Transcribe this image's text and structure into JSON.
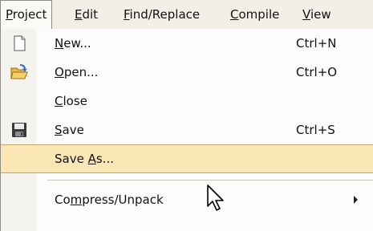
{
  "menubar": {
    "items": [
      {
        "label": "Project",
        "mnemonic": "P",
        "active": true
      },
      {
        "label": "Edit",
        "mnemonic": "E"
      },
      {
        "label": "Find/Replace",
        "mnemonic": "F"
      },
      {
        "label": "Compile",
        "mnemonic": "C"
      },
      {
        "label": "View",
        "mnemonic": "V"
      }
    ]
  },
  "menu": {
    "items": [
      {
        "label": "New...",
        "mnemonic_char": "N",
        "accelerator": "Ctrl+N",
        "icon": "new-file-icon"
      },
      {
        "label": "Open...",
        "mnemonic_char": "O",
        "accelerator": "Ctrl+O",
        "icon": "open-folder-icon"
      },
      {
        "label": "Close",
        "mnemonic_char": "C",
        "accelerator": "",
        "icon": ""
      },
      {
        "label": "Save",
        "mnemonic_char": "S",
        "accelerator": "Ctrl+S",
        "icon": "save-disk-icon"
      },
      {
        "label": "Save As...",
        "mnemonic_char": "A",
        "accelerator": "",
        "icon": "",
        "highlighted": true
      },
      {
        "label": "Compress/Unpack",
        "mnemonic_char": "m",
        "accelerator": "",
        "icon": "",
        "submenu": true
      }
    ]
  },
  "colors": {
    "menubar_bg": "#f1efe6",
    "highlight_bg": "#fae7b5",
    "highlight_border": "#c6a665",
    "gutter_bg": "#f4f3ee"
  }
}
